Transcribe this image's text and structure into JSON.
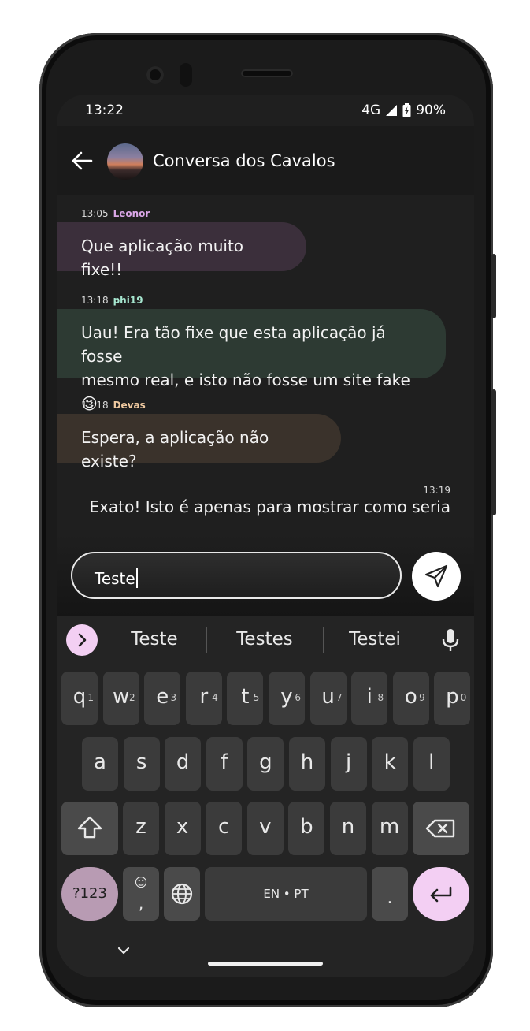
{
  "status": {
    "time": "13:22",
    "network": "4G",
    "battery": "90%"
  },
  "header": {
    "title": "Conversa dos Cavalos"
  },
  "messages": [
    {
      "time": "13:05",
      "author": "Leonor",
      "author_color": "#d9a6e6",
      "bubble_color": "#3b2f3b",
      "text": "Que aplicação muito fixe!!"
    },
    {
      "time": "13:18",
      "author": "phi19",
      "author_color": "#a6e6cf",
      "bubble_color": "#2d3a33",
      "text_line1": "Uau! Era tão fixe que esta aplicação já fosse",
      "text_line2": "mesmo real, e isto não fosse um site fake 😉"
    },
    {
      "time": "13:18",
      "author": "Devas",
      "author_color": "#efc9a0",
      "bubble_color": "#3a322b",
      "text": "Espera, a aplicação não existe?"
    },
    {
      "time": "13:19",
      "text": "Exato! Isto é apenas para mostrar como seria"
    }
  ],
  "composer": {
    "value": "Teste"
  },
  "keyboard": {
    "suggestions": [
      "Teste",
      "Testes",
      "Testei"
    ],
    "row1": [
      {
        "key": "q",
        "hint": "1"
      },
      {
        "key": "w",
        "hint": "2"
      },
      {
        "key": "e",
        "hint": "3"
      },
      {
        "key": "r",
        "hint": "4"
      },
      {
        "key": "t",
        "hint": "5"
      },
      {
        "key": "y",
        "hint": "6"
      },
      {
        "key": "u",
        "hint": "7"
      },
      {
        "key": "i",
        "hint": "8"
      },
      {
        "key": "o",
        "hint": "9"
      },
      {
        "key": "p",
        "hint": "0"
      }
    ],
    "row2": [
      "a",
      "s",
      "d",
      "f",
      "g",
      "h",
      "j",
      "k",
      "l"
    ],
    "row3": [
      "z",
      "x",
      "c",
      "v",
      "b",
      "n",
      "m"
    ],
    "symbols_label": "?123",
    "emoji_glyph": "☺",
    "comma_label": ",",
    "space_label": "EN • PT",
    "period_label": ".",
    "accent": "#f3cff3",
    "symbols_color": "#b89bb3"
  }
}
